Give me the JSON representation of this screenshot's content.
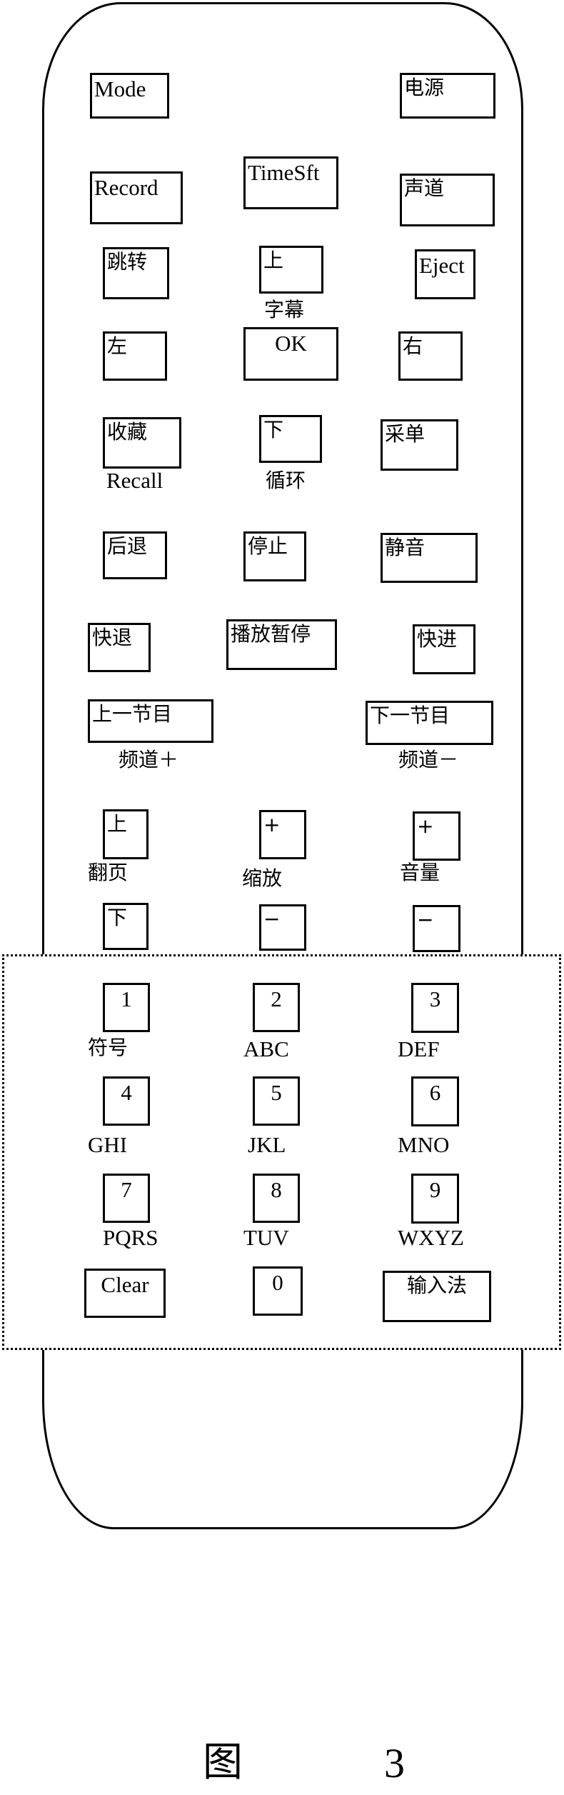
{
  "top_rows": {
    "mode": "Mode",
    "power": "电源",
    "record": "Record",
    "timeshift": "TimeSft",
    "audio_channel": "声道",
    "jump": "跳转",
    "up": "上",
    "eject": "Eject",
    "subtitle_label": "字幕",
    "left": "左",
    "ok": "OK",
    "right": "右",
    "favorite": "收藏",
    "down": "下",
    "menu": "采单",
    "recall_label": "Recall",
    "loop_label": "循环",
    "back": "后退",
    "stop": "停止",
    "mute": "静音",
    "rewind": "快退",
    "play_pause": "播放暂停",
    "fast_forward": "快进",
    "prev_program": "上一节目",
    "next_program": "下一节目",
    "channel_up_label": "频道＋",
    "channel_down_label": "频道－"
  },
  "rocker_rows": {
    "page_up": "上",
    "zoom_in": "+",
    "volume_up": "+",
    "page_label": "翻页",
    "zoom_label": "缩放",
    "volume_label": "音量",
    "page_down": "下",
    "zoom_out": "−",
    "volume_down": "−"
  },
  "keypad": {
    "keys": [
      {
        "digit": "1",
        "letters": "符号"
      },
      {
        "digit": "2",
        "letters": "ABC"
      },
      {
        "digit": "3",
        "letters": "DEF"
      },
      {
        "digit": "4",
        "letters": "GHI"
      },
      {
        "digit": "5",
        "letters": "JKL"
      },
      {
        "digit": "6",
        "letters": "MNO"
      },
      {
        "digit": "7",
        "letters": "PQRS"
      },
      {
        "digit": "8",
        "letters": "TUV"
      },
      {
        "digit": "9",
        "letters": "WXYZ"
      }
    ],
    "clear": "Clear",
    "zero": "0",
    "input_method": "输入法"
  },
  "figure": {
    "prefix": "图",
    "number": "3"
  }
}
